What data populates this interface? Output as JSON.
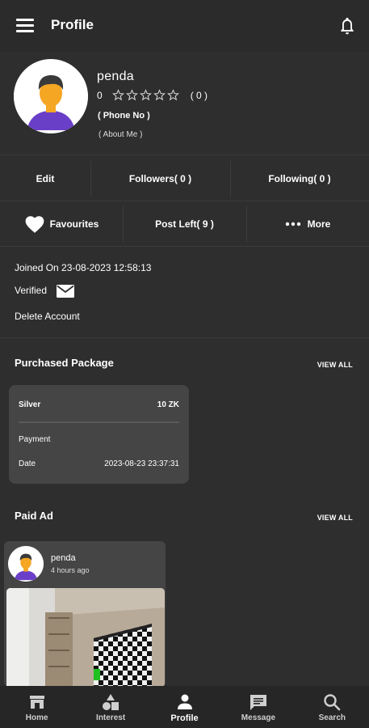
{
  "appbar": {
    "title": "Profile",
    "menu_icon": "menu-icon",
    "notification_icon": "bell-icon"
  },
  "profile": {
    "name": "penda",
    "rating_value": "0",
    "rating_count": "( 0 )",
    "stars_filled": 0,
    "stars_total": 5,
    "phone": "( Phone No )",
    "about": "( About Me )"
  },
  "stats": {
    "edit": "Edit",
    "followers": "Followers( 0 )",
    "following": "Following( 0 )",
    "favourites": "Favourites",
    "post_left": "Post Left( 9 )",
    "more": "More"
  },
  "account": {
    "joined": "Joined On 23-08-2023 12:58:13",
    "verified": "Verified",
    "delete": "Delete Account"
  },
  "purchased": {
    "title": "Purchased Package",
    "view_all": "VIEW ALL",
    "package_name": "Silver",
    "price": "10 ZK",
    "payment_label": "Payment",
    "payment_value": "",
    "date_label": "Date",
    "date_value": "2023-08-23 23:37:31"
  },
  "paid_ad": {
    "title": "Paid Ad",
    "view_all": "VIEW ALL",
    "user": "penda",
    "time": "4 hours ago"
  },
  "nav": {
    "items": [
      {
        "label": "Home",
        "icon": "home-icon"
      },
      {
        "label": "Interest",
        "icon": "shapes-icon"
      },
      {
        "label": "Profile",
        "icon": "person-icon"
      },
      {
        "label": "Message",
        "icon": "message-icon"
      },
      {
        "label": "Search",
        "icon": "search-icon"
      }
    ],
    "active": "Profile"
  },
  "colors": {
    "background": "#2e2e2e",
    "appbar": "#2b2b2b",
    "card": "#454545",
    "nav": "#262626",
    "avatar_shirt": "#6a3fc8",
    "avatar_skin": "#f5a623"
  }
}
